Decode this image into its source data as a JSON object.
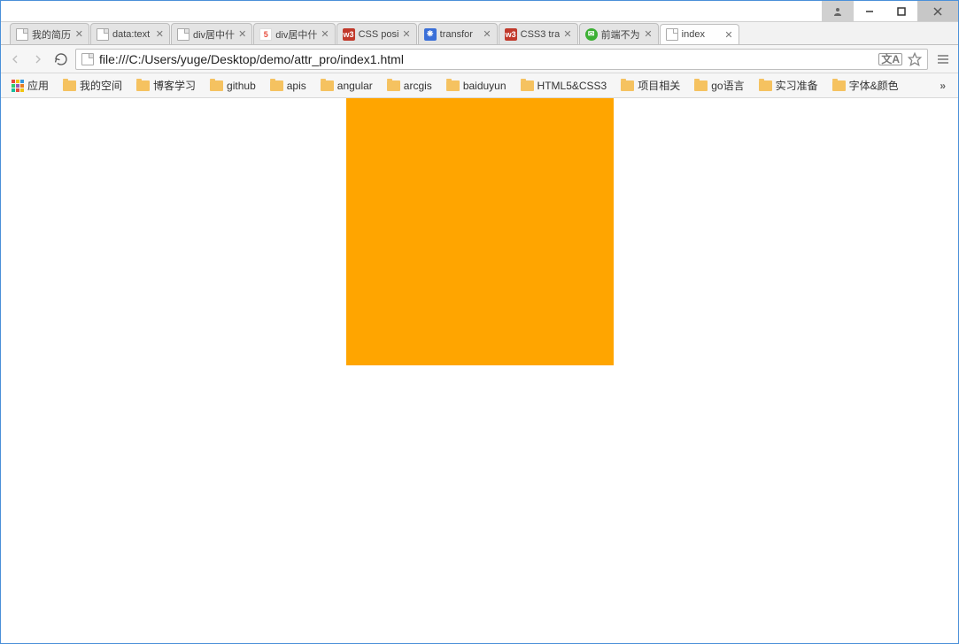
{
  "tabs": [
    {
      "label": "我的简历",
      "icon": "file"
    },
    {
      "label": "data:text",
      "icon": "file"
    },
    {
      "label": "div居中什",
      "icon": "file"
    },
    {
      "label": "div居中什",
      "icon": "5f"
    },
    {
      "label": "CSS posi",
      "icon": "w3"
    },
    {
      "label": "transfor",
      "icon": "baidu"
    },
    {
      "label": "CSS3 tra",
      "icon": "w3"
    },
    {
      "label": "前端不为",
      "icon": "wechat"
    },
    {
      "label": "index",
      "icon": "file",
      "active": true
    }
  ],
  "address": {
    "url": "file:///C:/Users/yuge/Desktop/demo/attr_pro/index1.html"
  },
  "bookmarks": {
    "apps_label": "应用",
    "items": [
      "我的空间",
      "博客学习",
      "github",
      "apis",
      "angular",
      "arcgis",
      "baiduyun",
      "HTML5&CSS3",
      "项目相关",
      "go语言",
      "实习准备",
      "字体&颜色"
    ],
    "overflow": "»"
  },
  "content": {
    "box_color": "#ffa500"
  }
}
